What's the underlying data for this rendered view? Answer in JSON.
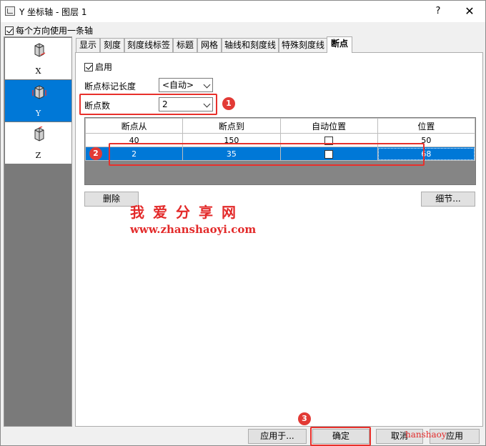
{
  "window": {
    "title": "Y 坐标轴 - 图层 1",
    "help": "?",
    "close": "✕"
  },
  "same_axis_label": "每个方向使用一条轴",
  "axes": [
    {
      "label": "X",
      "selected": false
    },
    {
      "label": "Y",
      "selected": true
    },
    {
      "label": "Z",
      "selected": false
    }
  ],
  "tabs": [
    {
      "label": "显示"
    },
    {
      "label": "刻度"
    },
    {
      "label": "刻度线标签"
    },
    {
      "label": "标题"
    },
    {
      "label": "网格"
    },
    {
      "label": "轴线和刻度线"
    },
    {
      "label": "特殊刻度线"
    },
    {
      "label": "断点",
      "active": true
    }
  ],
  "breaks": {
    "enable_label": "启用",
    "enabled": true,
    "mark_length_label": "断点标记长度",
    "mark_length_value": "<自动>",
    "count_label": "断点数",
    "count_value": "2",
    "columns": [
      "断点从",
      "断点到",
      "自动位置",
      "位置"
    ],
    "rows": [
      {
        "from": "40",
        "to": "150",
        "auto": false,
        "position": "50"
      },
      {
        "from": "2",
        "to": "35",
        "auto": false,
        "position": "68"
      }
    ],
    "delete_label": "删除",
    "detail_label": "细节..."
  },
  "annotations": {
    "badge1": "1",
    "badge2": "2",
    "badge3": "3"
  },
  "watermark": {
    "cn": "我爱分享网",
    "url": "www.zhanshaoyi.com",
    "corner": "hanshaoy"
  },
  "footer": {
    "apply_to": "应用于...",
    "ok": "确定",
    "cancel": "取消",
    "apply": "应用"
  },
  "colors": {
    "selection": "#0078d7",
    "annotation_red": "#e8302b"
  }
}
